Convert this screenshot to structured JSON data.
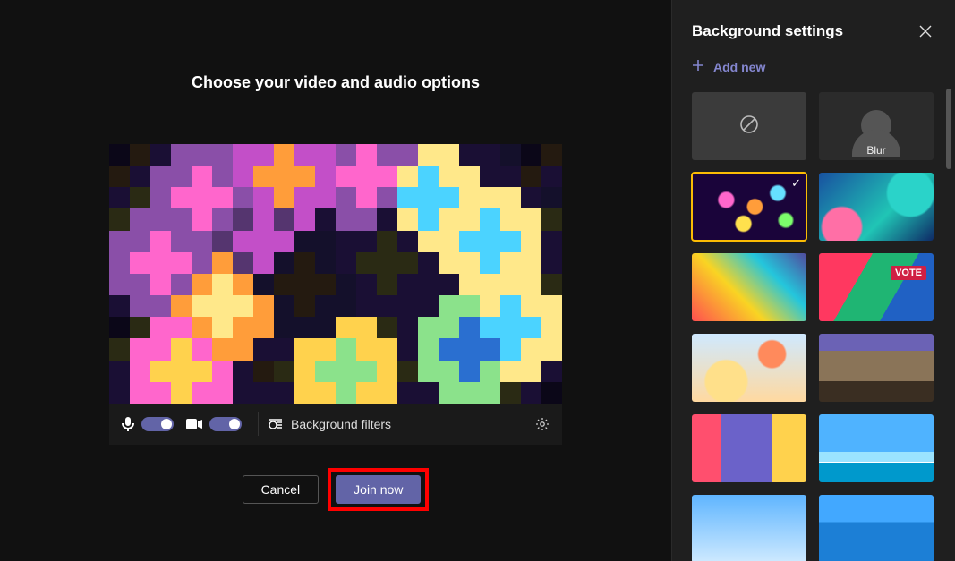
{
  "main": {
    "title": "Choose your video and audio options",
    "controls": {
      "bg_filters_label": "Background filters"
    },
    "buttons": {
      "cancel": "Cancel",
      "join": "Join now"
    }
  },
  "side": {
    "title": "Background settings",
    "add_new": "Add new",
    "blur_label": "Blur"
  }
}
